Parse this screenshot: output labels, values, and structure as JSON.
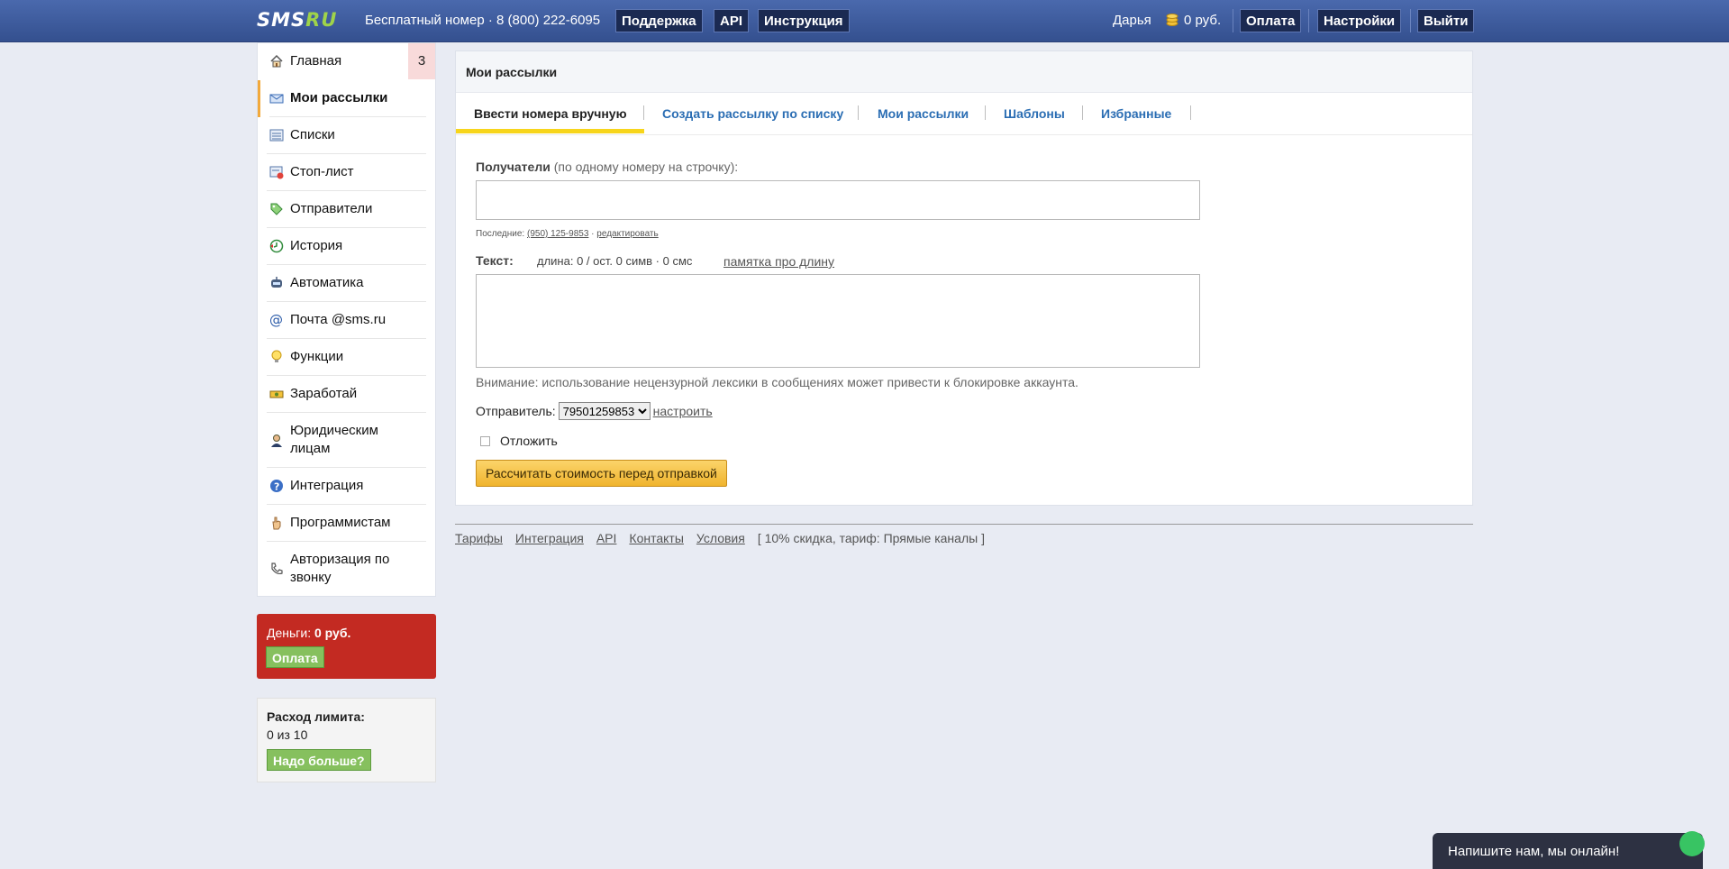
{
  "topbar": {
    "logo_part1": "SMS",
    "logo_part2": "RU",
    "free_number": "Бесплатный номер · 8 (800) 222-6095",
    "support": "Поддержка",
    "api": "API",
    "instructions": "Инструкция",
    "username": "Дарья",
    "balance": "0 руб.",
    "payment": "Оплата",
    "settings": "Настройки",
    "logout": "Выйти"
  },
  "sidebar": {
    "items": [
      {
        "label": "Главная",
        "icon": "home-icon",
        "badge": "3"
      },
      {
        "label": "Мои рассылки",
        "icon": "mail-icon"
      },
      {
        "label": "Списки",
        "icon": "list-icon"
      },
      {
        "label": "Стоп-лист",
        "icon": "stoplist-icon"
      },
      {
        "label": "Отправители",
        "icon": "tag-icon"
      },
      {
        "label": "История",
        "icon": "history-icon"
      },
      {
        "label": "Автоматика",
        "icon": "robot-icon"
      },
      {
        "label": "Почта @sms.ru",
        "icon": "at-icon"
      },
      {
        "label": "Функции",
        "icon": "bulb-icon"
      },
      {
        "label": "Заработай",
        "icon": "money-icon"
      },
      {
        "label": "Юридическим лицам",
        "icon": "person-icon"
      },
      {
        "label": "Интеграция",
        "icon": "help-icon"
      },
      {
        "label": "Программистам",
        "icon": "hand-icon"
      },
      {
        "label": "Авторизация по звонку",
        "icon": "phone-icon"
      }
    ],
    "money_label": "Деньги:",
    "money_value": "0 руб.",
    "money_pay": "Оплата",
    "limit_title": "Расход лимита:",
    "limit_usage": "0 из 10",
    "limit_more": "Надо больше?"
  },
  "panel": {
    "title": "Мои рассылки",
    "tabs": [
      "Ввести номера вручную",
      "Создать рассылку по списку",
      "Мои рассылки",
      "Шаблоны",
      "Избранные"
    ],
    "recipients_label": "Получатели",
    "recipients_hint": "(по одному номеру на строчку):",
    "recent_label": "Последние:",
    "recent_number": "(950) 125-9853",
    "recent_sep": "·",
    "recent_edit": "редактировать",
    "text_label": "Текст:",
    "text_counter": "длина: 0 / ост. 0 симв · 0 смс",
    "length_memo": "памятка про длину",
    "warning": "Внимание: использование нецензурной лексики в сообщениях может привести к блокировке аккаунта.",
    "sender_label": "Отправитель:",
    "sender_value": "79501259853",
    "sender_setup": "настроить",
    "postpone": "Отложить",
    "calc_button": "Рассчитать стоимость перед отправкой"
  },
  "footer": {
    "links": [
      "Тарифы",
      "Интеграция",
      "API",
      "Контакты",
      "Условия"
    ],
    "note": "[ 10% скидка, тариф: Прямые каналы ]"
  },
  "chat": {
    "text": "Напишите нам, мы онлайн!"
  }
}
